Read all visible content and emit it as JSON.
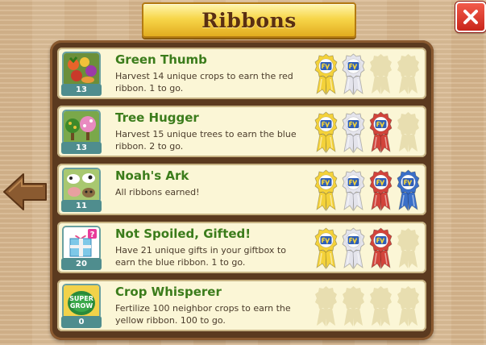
{
  "title": "Ribbons",
  "ribbon_colors": {
    "yellow": "#f4d23a",
    "white": "#e4e4ec",
    "red": "#d2443b",
    "blue": "#3a6fc8",
    "empty": "#e8deb0"
  },
  "items": [
    {
      "name": "Green Thumb",
      "count": "13",
      "description": "Harvest 14 unique crops to earn the red ribbon. 1 to go.",
      "icon": "vegetables-icon",
      "ribbons": [
        "yellow",
        "white",
        "empty",
        "empty"
      ]
    },
    {
      "name": "Tree Hugger",
      "count": "13",
      "description": "Harvest 15 unique trees to earn the blue ribbon. 2 to go.",
      "icon": "trees-icon",
      "ribbons": [
        "yellow",
        "white",
        "red",
        "empty"
      ]
    },
    {
      "name": "Noah's Ark",
      "count": "11",
      "description": "All ribbons earned!",
      "icon": "animals-icon",
      "ribbons": [
        "yellow",
        "white",
        "red",
        "blue"
      ]
    },
    {
      "name": "Not Spoiled, Gifted!",
      "count": "20",
      "description": "Have 21 unique gifts in your giftbox to earn the blue ribbon. 1 to go.",
      "icon": "gift-icon",
      "ribbons": [
        "yellow",
        "white",
        "red",
        "empty"
      ]
    },
    {
      "name": "Crop Whisperer",
      "count": "0",
      "description": "Fertilize 100 neighbor crops to earn the yellow ribbon. 100 to go.",
      "icon": "fertilizer-icon",
      "icon_text": "SUPER GROW",
      "ribbons": [
        "empty",
        "empty",
        "empty",
        "empty"
      ]
    }
  ]
}
